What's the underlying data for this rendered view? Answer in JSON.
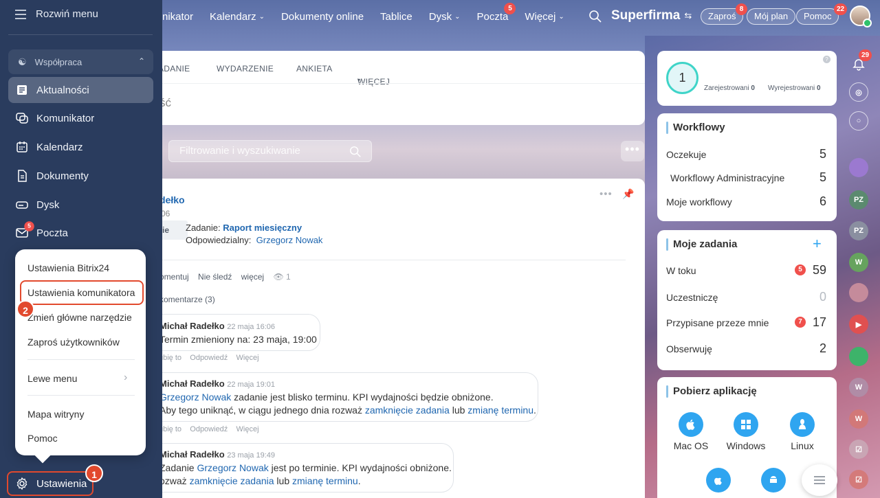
{
  "topnav": {
    "items": [
      {
        "label": "nikator",
        "caret": false
      },
      {
        "label": "Kalendarz",
        "caret": true
      },
      {
        "label": "Dokumenty online",
        "caret": false
      },
      {
        "label": "Tablice",
        "caret": false
      },
      {
        "label": "Dysk",
        "caret": true
      },
      {
        "label": "Poczta",
        "caret": false,
        "badge": "5"
      },
      {
        "label": "Więcej",
        "caret": true
      }
    ],
    "brand": "Superfirma",
    "invite": {
      "label": "Zaproś",
      "badge": "8"
    },
    "myplan": "Mój plan",
    "help": {
      "label": "Pomoc",
      "badge": "22"
    }
  },
  "sidebar": {
    "toggle": "Rozwiń menu",
    "group": "Współpraca",
    "items": [
      {
        "label": "Aktualności",
        "icon": "news-icon",
        "active": true
      },
      {
        "label": "Komunikator",
        "icon": "chat-icon"
      },
      {
        "label": "Kalendarz",
        "icon": "calendar-icon"
      },
      {
        "label": "Dokumenty",
        "icon": "document-icon"
      },
      {
        "label": "Dysk",
        "icon": "drive-icon"
      },
      {
        "label": "Poczta",
        "icon": "mail-icon",
        "badge": "5"
      }
    ],
    "settings": "Ustawienia",
    "step1": "1",
    "step2": "2"
  },
  "popup": {
    "items": [
      "Ustawienia Bitrix24",
      "Ustawienia komunikatora",
      "Zmień główne narzędzie",
      "Zaproś użytkowników",
      "Lewe menu",
      "Mapa witryny",
      "Pomoc"
    ]
  },
  "feed": {
    "tabs": [
      "ADANIE",
      "WYDARZENIE",
      "ANKIETA",
      "WIĘCEJ"
    ],
    "compose_placeholder": "ść",
    "filter_placeholder": "Filtrowanie i wyszukiwanie",
    "post": {
      "author": "dełko",
      "date": "06",
      "type_chip": "ie",
      "task_label": "Zadanie:",
      "task_name": "Raport miesięczny",
      "resp_label": "Odpowiedzialny:",
      "resp_name": "Grzegorz Nowak",
      "actions": [
        "omentuj",
        "Nie śledź",
        "więcej"
      ],
      "views": "1",
      "comments_link": "komentarze (3)"
    },
    "comments": [
      {
        "author": "Michał Radełko",
        "date": "22 maja 16:06",
        "line1": "Termin zmieniony na: 23 maja, 19:00",
        "line2": ""
      },
      {
        "author": "Michał Radełko",
        "date": "22 maja 19:01",
        "line1_link": "Grzegorz Nowak",
        "line1": " zadanie jest blisko terminu. KPI wydajności będzie obniżone.",
        "line2_pre": "Aby tego uniknąć, w ciągu jednego dnia rozważ ",
        "line2_link1": "zamknięcie zadania",
        "line2_mid": " lub ",
        "line2_link2": "zmianę terminu",
        "line2_end": "."
      },
      {
        "author": "Michał Radełko",
        "date": "23 maja 19:49",
        "line1_pre": "Zadanie ",
        "line1_link": "Grzegorz Nowak",
        "line1": " jest po terminie. KPI wydajności obniżone.",
        "line2_pre": "ozważ ",
        "line2_link1": "zamknięcie zadania",
        "line2_mid": " lub ",
        "line2_link2": "zmianę terminu",
        "line2_end": "."
      }
    ],
    "comment_actions": [
      "ubię to",
      "Odpowiedź",
      "Więcej"
    ]
  },
  "rightcol": {
    "counter": "1",
    "registered_label": "Zarejestrowani",
    "registered": "0",
    "unregistered_label": "Wyrejestrowani",
    "unregistered": "0",
    "workflows": {
      "title": "Workflowy",
      "rows": [
        {
          "label": "Oczekuje",
          "value": "5"
        },
        {
          "label": "Workflowy Administracyjne",
          "value": "5"
        },
        {
          "label": "Moje workflowy",
          "value": "6"
        }
      ]
    },
    "tasks": {
      "title": "Moje zadania",
      "rows": [
        {
          "label": "W toku",
          "value": "59",
          "badge": "5"
        },
        {
          "label": "Uczestniczę",
          "value": "0"
        },
        {
          "label": "Przypisane przeze mnie",
          "value": "17",
          "badge": "7"
        },
        {
          "label": "Obserwuję",
          "value": "2"
        }
      ]
    },
    "apps": {
      "title": "Pobierz aplikację",
      "items": [
        "Mac OS",
        "Windows",
        "Linux"
      ]
    }
  },
  "rail": {
    "notifications_badge": "29",
    "avatars": [
      "PZ",
      "PZ",
      "W",
      "W",
      "W"
    ]
  },
  "colors": {
    "sidebar": "#2a3c5e",
    "accent": "#2fa5f0",
    "badge": "#f0504c",
    "highlight": "#e2492d",
    "link": "#2067b0"
  }
}
